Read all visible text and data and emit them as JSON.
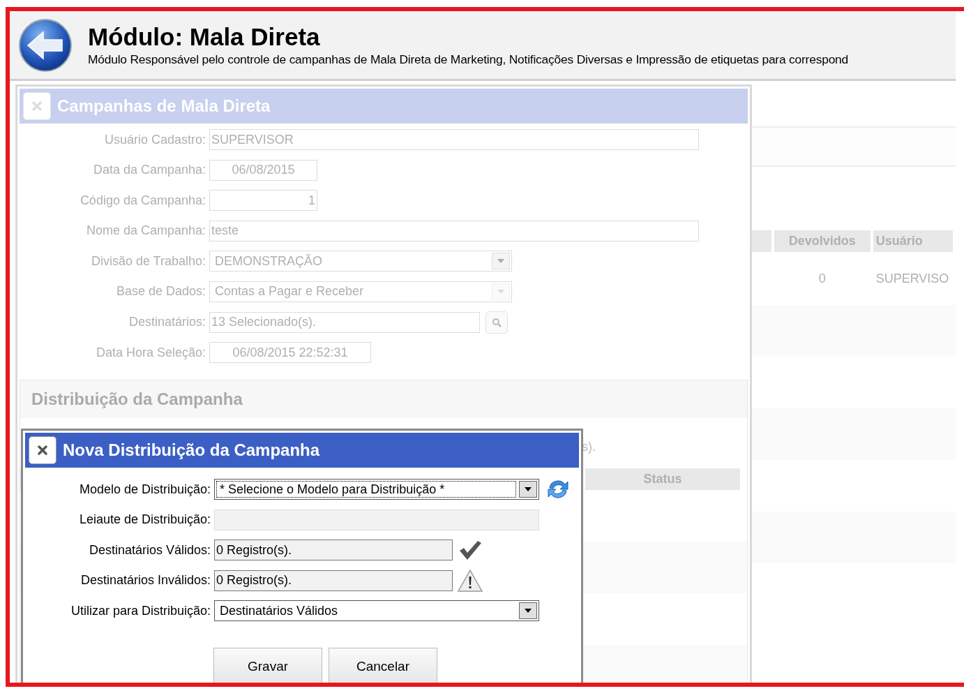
{
  "header": {
    "title": "Módulo: Mala Direta",
    "subtitle": "Módulo Responsável pelo controle de campanhas de Mala Direta de Marketing, Notificações Diversas e Impressão de etiquetas para correspond"
  },
  "campaign_panel": {
    "title": "Campanhas de Mala Direta",
    "fields": [
      {
        "label": "Usuário Cadastro:",
        "kind": "text",
        "value": "SUPERVISOR"
      },
      {
        "label": "Data da Campanha:",
        "kind": "date",
        "value": "06/08/2015"
      },
      {
        "label": "Código da Campanha:",
        "kind": "number",
        "value": "1"
      },
      {
        "label": "Nome da Campanha:",
        "kind": "text",
        "value": "teste"
      },
      {
        "label": "Divisão de Trabalho:",
        "kind": "select",
        "value": "DEMONSTRAÇÃO",
        "disabled": false
      },
      {
        "label": "Base de Dados:",
        "kind": "select",
        "value": "Contas a Pagar e Receber",
        "disabled": true
      },
      {
        "label": "Destinatários:",
        "kind": "lookup",
        "value": "13 Selecionado(s)."
      },
      {
        "label": "Data Hora Seleção:",
        "kind": "datetime",
        "value": "06/08/2015 22:52:31"
      }
    ]
  },
  "distribution": {
    "title": "Distribuição da Campanha",
    "note": "s).",
    "columns": [
      "Status"
    ]
  },
  "side_table": {
    "columns": [
      "Devolvidos",
      "Usuário"
    ],
    "rows": [
      [
        "0",
        "SUPERVISO"
      ]
    ]
  },
  "modal": {
    "title": "Nova Distribuição da Campanha",
    "fields": [
      {
        "label": "Modelo de Distribuição:",
        "kind": "select-refresh",
        "value": "* Selecione o Modelo para Distribuição *",
        "focused": true
      },
      {
        "label": "Leiaute de Distribuição:",
        "kind": "text"
      },
      {
        "label": "Destinatários Válidos:",
        "kind": "status-ok",
        "value": "0 Registro(s)."
      },
      {
        "label": "Destinatários Inválidos:",
        "kind": "status-warning",
        "value": "0 Registro(s)."
      },
      {
        "label": "Utilizar para Distribuição:",
        "kind": "select",
        "value": "Destinatários Válidos",
        "focused": false
      }
    ],
    "buttons": [
      "Gravar",
      "Cancelar"
    ]
  }
}
